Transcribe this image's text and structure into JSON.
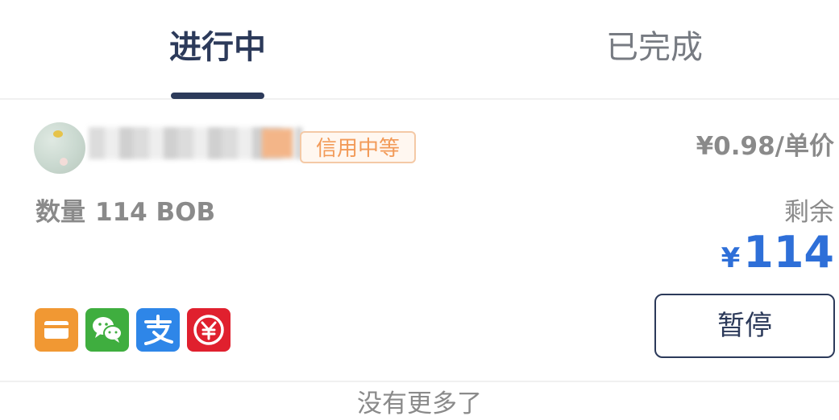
{
  "tabs": {
    "active": "进行中",
    "inactive": "已完成"
  },
  "order": {
    "credit_badge": "信用中等",
    "price": "¥0.98/单价",
    "quantity_label": "数量",
    "quantity_value": "114 BOB",
    "remaining_label": "剩余",
    "remaining_currency": "¥",
    "remaining_amount": "114",
    "payment_methods": [
      "bank-card-icon",
      "wechat-pay-icon",
      "alipay-icon",
      "digital-rmb-icon"
    ],
    "pause_button": "暂停"
  },
  "footer": {
    "no_more": "没有更多了"
  },
  "colors": {
    "tab_active": "#2c3a5a",
    "accent_amount": "#2e6fd8",
    "badge": "#f29a58",
    "card": "#f19833",
    "wechat": "#3fae3f",
    "alipay": "#2e86e8",
    "ecny": "#e0202e"
  }
}
